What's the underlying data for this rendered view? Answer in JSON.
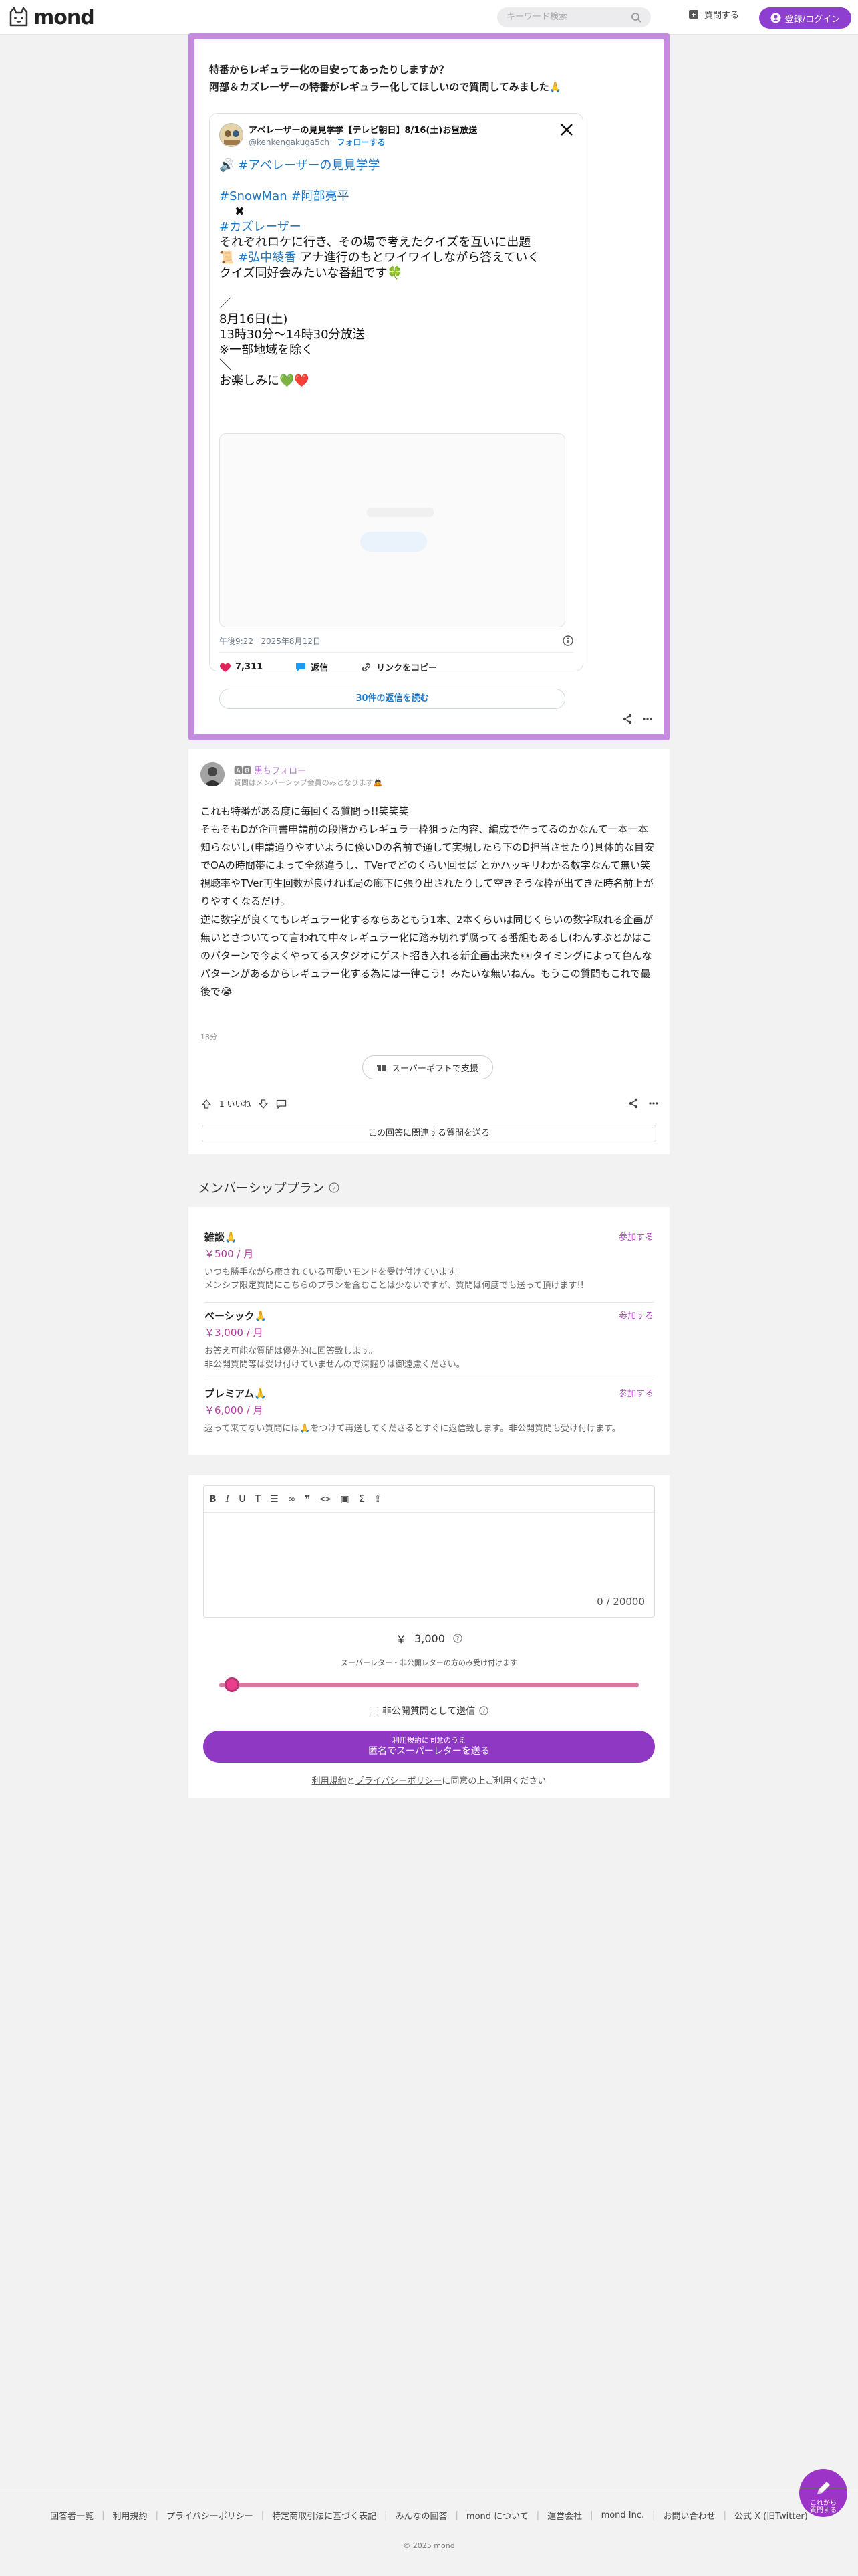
{
  "header": {
    "logo_text": "mond",
    "search_placeholder": "キーワード検索",
    "ask_label": "質問する",
    "login_label": "登録/ログイン"
  },
  "question": {
    "line1": "特番からレギュラー化の目安ってあったりしますか？",
    "line2": "阿部＆カズレーザーの特番がレギュラー化してほしいので質問してみました🙏"
  },
  "tweet": {
    "name": "アベレーザーの見見学学【テレビ朝日】8/16(土)お昼放送",
    "handle": "@kenkengakuga5ch",
    "follow": "フォローする",
    "body": [
      {
        "text": "🔊 "
      },
      {
        "text": "#アベレーザーの見見学学",
        "tag": true
      },
      {
        "text": "\n\n"
      },
      {
        "text": "#SnowMan",
        "tag": true
      },
      {
        "text": " "
      },
      {
        "text": "#阿部亮平",
        "tag": true
      },
      {
        "text": "\n    ✖\n"
      },
      {
        "text": "#カズレーザー",
        "tag": true
      },
      {
        "text": "\nそれぞれロケに行き、その場で考えたクイズを互いに出題\n📜 "
      },
      {
        "text": "#弘中綾香",
        "tag": true
      },
      {
        "text": " アナ進行のもとワイワイしながら答えていく\nクイズ同好会みたいな番組です🍀\n\n／\n8月16日(土)\n13時30分〜14時30分放送\n※一部地域を除く\n＼\nお楽しみに💚❤️"
      }
    ],
    "time": "午後9:22 · 2025年8月12日",
    "likes": "7,311",
    "reply_label": "返信",
    "copy_link": "リンクをコピー",
    "read_replies": "30件の返信を読む"
  },
  "answer": {
    "name": "🅰🅱",
    "follow": "黒ちフォロー",
    "subtitle": "質問はメンバーシップ会員のみとなります🙇",
    "body": "これも特番がある度に毎回くる質問っ!!笑笑笑\nそもそもDが企画書申請前の段階からレギュラー枠狙った内容、編成で作ってるのかなんて一本一本知らないし(申請通りやすいように倹いDの名前で通して実現したら下のD担当させたり)具体的な目安でOAの時間帯によって全然違うし、TVerでどのくらい回せば とかハッキリわかる数字なんて無い笑\n視聴率やTVer再生回数が良ければ局の廊下に張り出されたりして空きそうな枠が出てきた時名前上がりやすくなるだけ。\n逆に数字が良くてもレギュラー化するならあともう1本、2本くらいは同じくらいの数字取れる企画が無いとさついてって言われて中々レギュラー化に踏み切れず腐ってる番組もあるし(わんすぶとかはこのパターンで今よくやってるスタジオにゲスト招き入れる新企画出来た👀タイミングによって色んなパターンがあるからレギュラー化する為には一律こう！みたいな無いねん。もうこの質問もこれで最後で😭",
    "time": "18分",
    "supergift": "スーパーギフトで支援",
    "likes": "1 いいね",
    "related": "この回答に関連する質問を送る"
  },
  "membership": {
    "title": "メンバーシッププラン",
    "join_label": "参加する",
    "plans": [
      {
        "name": "雑談🙏",
        "price": "￥500 / 月",
        "desc": "いつも勝手ながら癒されている可愛いモンドを受け付けています。\nメンシプ限定質問にこちらのプランを含むことは少ないですが、質問は何度でも送って頂けます!!"
      },
      {
        "name": "ベーシック🙏",
        "price": "￥3,000 / 月",
        "desc": "お答え可能な質問は優先的に回答致します。\n非公開質問等は受け付けていませんので深掘りは御遠慮ください。"
      },
      {
        "name": "プレミアム🙏",
        "price": "￥6,000 / 月",
        "desc": "返って来てない質問には🙏をつけて再送してくださるとすぐに返信致します。非公開質問も受け付けます。"
      }
    ]
  },
  "form": {
    "counter": "0 / 20000",
    "currency": "￥",
    "amount": "3,000",
    "slider_caption": "スーパーレター・非公開レターの方のみ受け付けます",
    "slider_fraction": 0.03,
    "private_label": "非公開質問として送信",
    "submit_small": "利用規約に同意のうえ",
    "submit_main": "匿名でスーパーレターを送る",
    "terms_a": "利用規約",
    "terms_mid": "と",
    "terms_b": "プライバシーポリシー",
    "terms_end": "に同意の上ご利用ください"
  },
  "fab": {
    "line1": "これから",
    "line2": "質問する"
  },
  "footer": {
    "links": [
      "回答者一覧",
      "利用規約",
      "プライバシーポリシー",
      "特定商取引法に基づく表記",
      "みんなの回答",
      "mond について",
      "運営会社",
      "mond Inc.",
      "お問い合わせ",
      "公式 X (旧Twitter)"
    ],
    "copyright": "© 2025 mond"
  },
  "colors": {
    "accent": "#8e3fcf",
    "highlight_border": "#c48be0",
    "price": "#b43ba0",
    "link": "#1d78c8"
  }
}
